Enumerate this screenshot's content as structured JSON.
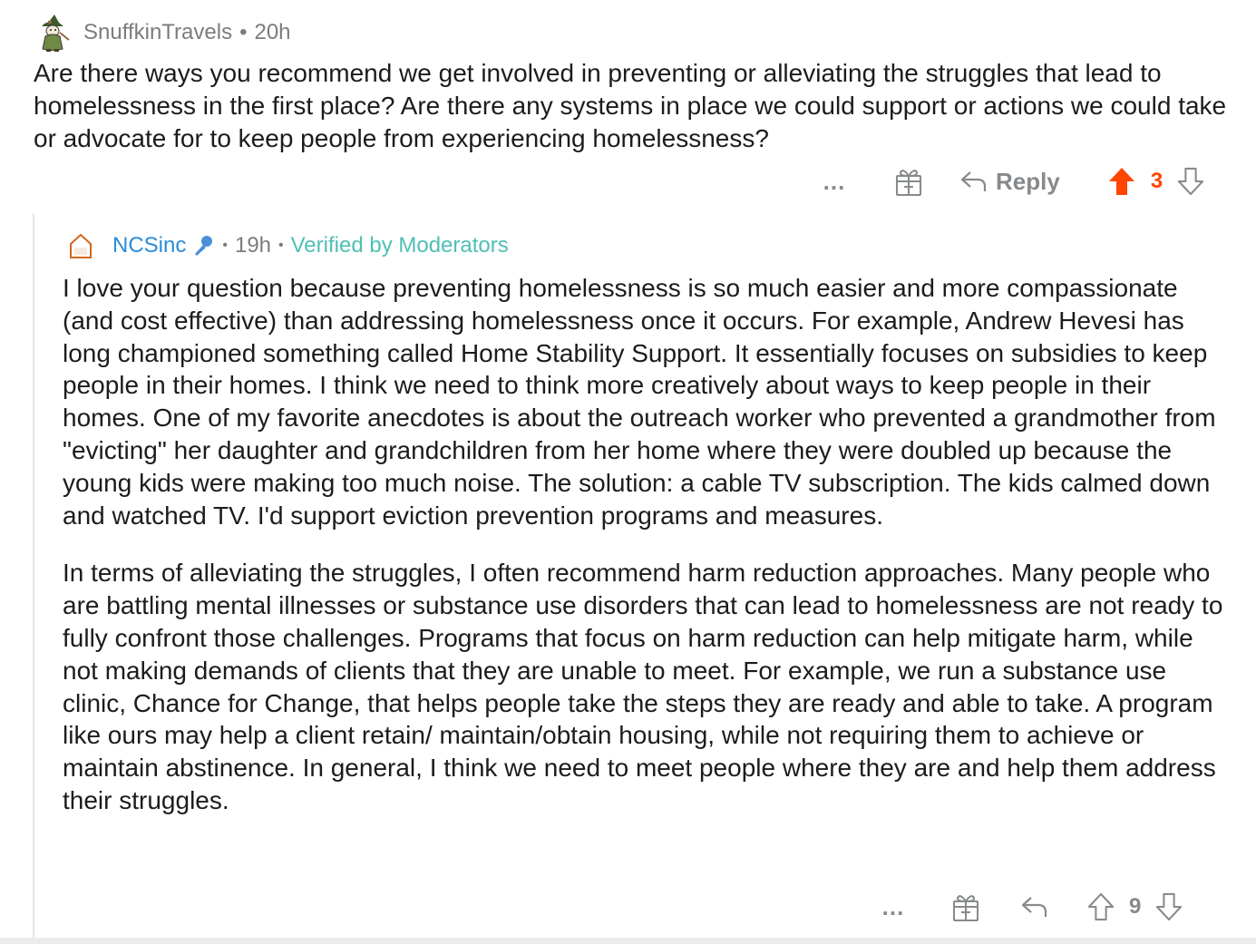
{
  "comment": {
    "username": "SnuffkinTravels",
    "separator": "•",
    "time": "20h",
    "avatar_icon": "snufkin-avatar-icon",
    "body": "Are there ways you recommend we get involved in preventing or alleviating the struggles that lead to homelessness in the first place? Are there any systems in place we could support or actions we could take or advocate for to keep people from experiencing homelessness?",
    "actions": {
      "more_label": "...",
      "award_icon": "gift-award-icon",
      "reply_icon": "reply-arrow-icon",
      "reply_label": "Reply",
      "upvote_icon": "upvote-arrow-icon",
      "upvoted": true,
      "score": "3",
      "downvote_icon": "downvote-arrow-icon"
    }
  },
  "reply": {
    "username": "NCSinc",
    "user_flair_icon": "microphone-icon",
    "separator": "•",
    "time": "19h",
    "verified_label": "Verified by Moderators",
    "avatar_icon": "ncs-house-logo-icon",
    "paragraphs": [
      "I love your question because preventing homelessness is so much easier and more compassionate (and cost effective) than addressing homelessness once it occurs. For example, Andrew Hevesi has long championed something called Home Stability Support. It essentially focuses on subsidies to keep people in their homes. I think we need to think more creatively about ways to keep people in their homes. One of my favorite anecdotes is about the outreach worker who prevented a grandmother from \"evicting\" her daughter and grandchildren from her home where they were doubled up because the young kids were making too much noise. The solution: a cable TV subscription. The kids calmed down and watched TV. I'd support eviction prevention programs and measures.",
      "In terms of alleviating the struggles, I often recommend harm reduction approaches. Many people who are battling mental illnesses or substance use disorders that can lead to homelessness are not ready to fully confront those challenges. Programs that focus on harm reduction can help mitigate harm, while not making demands of clients that they are unable to meet. For example, we run a substance use clinic, Chance for Change, that helps people take the steps they are ready and able to take. A program like ours may help a client retain/ maintain/obtain housing, while not requiring them to achieve or maintain abstinence. In general, I think we need to meet people where they are and help them address their struggles."
    ],
    "actions": {
      "more_label": "...",
      "award_icon": "gift-award-icon",
      "reply_icon": "reply-arrow-icon",
      "upvote_icon": "upvote-arrow-icon",
      "upvoted": false,
      "score": "9",
      "downvote_icon": "downvote-arrow-icon"
    }
  },
  "colors": {
    "upvote_active": "#ff4500",
    "username_link": "#2a8cd9",
    "verified": "#4fbfb5",
    "meta_gray": "#7c7c7c",
    "icon_gray": "#878a8c",
    "thread_line": "#e5e5e5"
  }
}
